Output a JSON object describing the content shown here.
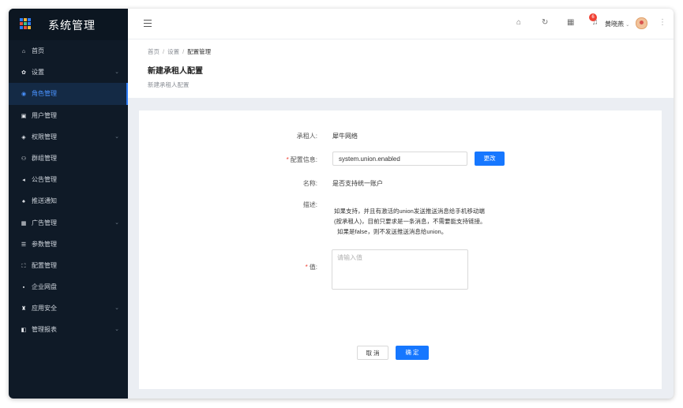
{
  "app": {
    "title": "系统管理"
  },
  "sidebar": {
    "items": [
      {
        "label": "首页",
        "icon": "home-icon",
        "glyph": "⌂",
        "has_sub": false
      },
      {
        "label": "设置",
        "icon": "gear-icon",
        "glyph": "✿",
        "has_sub": true
      },
      {
        "label": "角色管理",
        "icon": "role-icon",
        "glyph": "◉",
        "has_sub": false,
        "active": true
      },
      {
        "label": "用户管理",
        "icon": "user-icon",
        "glyph": "▣",
        "has_sub": false
      },
      {
        "label": "权限管理",
        "icon": "shield-icon",
        "glyph": "◈",
        "has_sub": true
      },
      {
        "label": "群组管理",
        "icon": "group-icon",
        "glyph": "⚇",
        "has_sub": false
      },
      {
        "label": "公告管理",
        "icon": "megaphone-icon",
        "glyph": "◂",
        "has_sub": false
      },
      {
        "label": "推送通知",
        "icon": "bell-icon",
        "glyph": "♠",
        "has_sub": false
      },
      {
        "label": "广告管理",
        "icon": "ad-icon",
        "glyph": "▦",
        "has_sub": true
      },
      {
        "label": "参数管理",
        "icon": "params-icon",
        "glyph": "☰",
        "has_sub": false
      },
      {
        "label": "配置管理",
        "icon": "config-icon",
        "glyph": "⛶",
        "has_sub": false
      },
      {
        "label": "企业网盘",
        "icon": "disk-icon",
        "glyph": "▪",
        "has_sub": false
      },
      {
        "label": "应用安全",
        "icon": "security-icon",
        "glyph": "♜",
        "has_sub": true
      },
      {
        "label": "管理报表",
        "icon": "report-icon",
        "glyph": "◧",
        "has_sub": true
      }
    ]
  },
  "header": {
    "notification_count": "6",
    "user_name": "黄晓燕"
  },
  "breadcrumb": {
    "items": [
      "首页",
      "设置",
      "配置管理"
    ]
  },
  "page": {
    "title": "新建承租人配置",
    "subtitle": "新建承租人配置"
  },
  "form": {
    "tenant_label": "承租人:",
    "tenant_value": "犀牛网络",
    "config_label": "配置信息:",
    "config_value": "system.union.enabled",
    "change_button": "更改",
    "name_label": "名称:",
    "name_value": "是否支持统一账户",
    "desc_label": "描述:",
    "desc_lines": [
      "如果支持，并且有激活的union发送推送消息给手机移动端",
      "(按承租人)，目前只要求是一条消息，不需要能支持链接。",
      "如果是false，则不发送推送消息给union。"
    ],
    "value_label": "值:",
    "value_placeholder": "请输入值",
    "cancel_button": "取 消",
    "confirm_button": "确 定"
  },
  "colors": {
    "primary": "#1677ff",
    "sidebar_bg": "#0f1a27",
    "required": "#f04134"
  }
}
